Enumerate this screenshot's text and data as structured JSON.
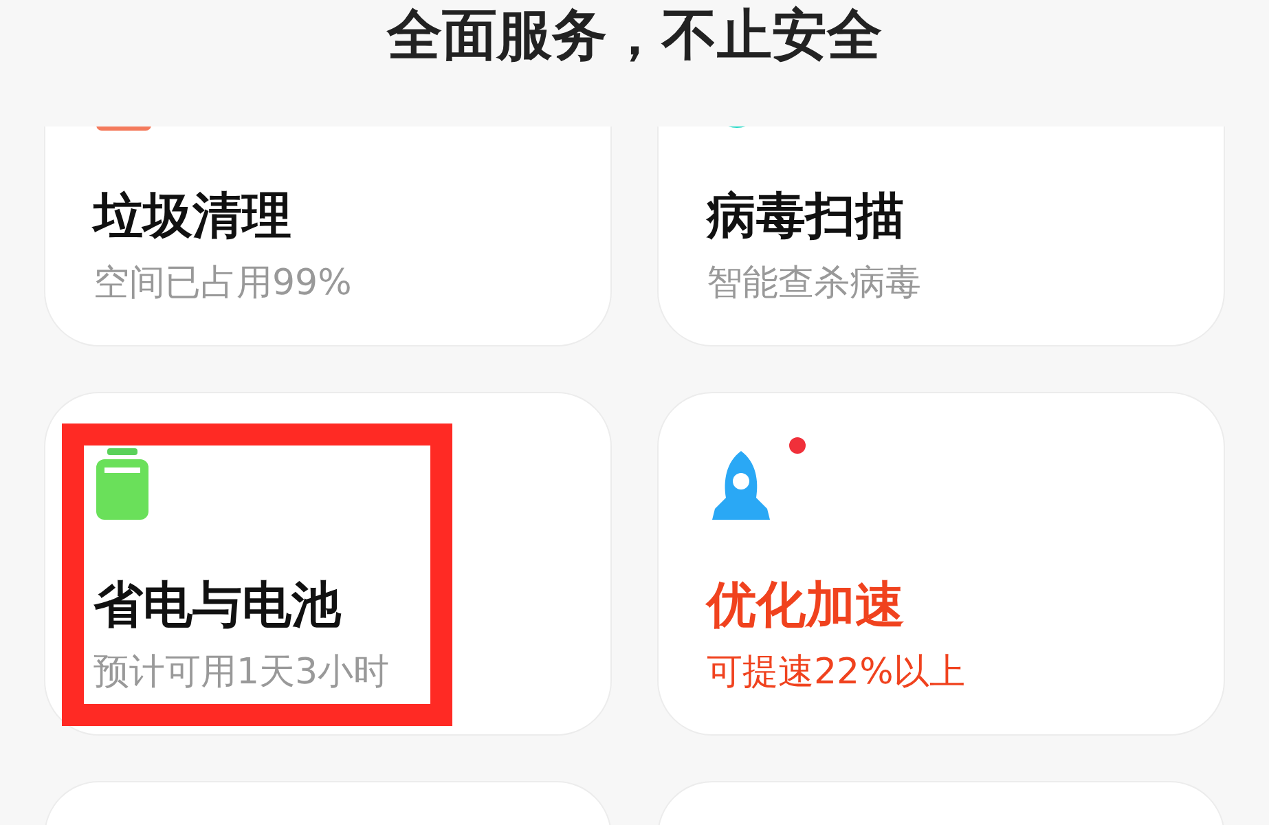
{
  "header": {
    "title": "全面服务，不止安全"
  },
  "cards": [
    {
      "kind": "bar",
      "title": "垃圾清理",
      "subtitle": "空间已占用99%",
      "emphasized": false,
      "badge": false,
      "highlighted": false
    },
    {
      "kind": "circle",
      "title": "病毒扫描",
      "subtitle": "智能查杀病毒",
      "emphasized": false,
      "badge": false,
      "highlighted": false
    },
    {
      "kind": "battery",
      "title": "省电与电池",
      "subtitle": "预计可用1天3小时",
      "emphasized": false,
      "badge": false,
      "highlighted": true
    },
    {
      "kind": "rocket",
      "title": "优化加速",
      "subtitle": "可提速22%以上",
      "emphasized": true,
      "badge": true,
      "highlighted": false
    },
    {
      "kind": "empty"
    },
    {
      "kind": "empty"
    }
  ]
}
